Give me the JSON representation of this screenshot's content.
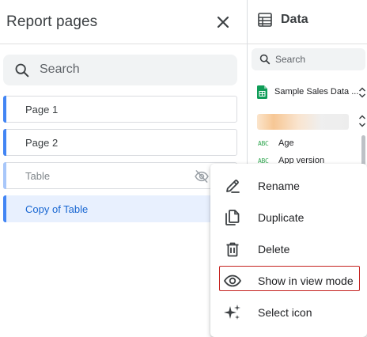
{
  "report_pages": {
    "title": "Report pages",
    "search": {
      "placeholder": "Search",
      "value": ""
    },
    "pages": [
      {
        "label": "Page 1",
        "state": "normal"
      },
      {
        "label": "Page 2",
        "state": "normal"
      },
      {
        "label": "Table",
        "state": "hidden"
      },
      {
        "label": "Copy of Table",
        "state": "selected"
      }
    ]
  },
  "data_panel": {
    "title": "Data",
    "search": {
      "placeholder": "Search",
      "value": ""
    },
    "source": {
      "name": "Sample Sales Data ..."
    },
    "fields": [
      {
        "type_badge": "ABC",
        "name": "Age"
      },
      {
        "type_badge": "ABC",
        "name": "App version"
      }
    ]
  },
  "context_menu": {
    "items": [
      {
        "label": "Rename",
        "icon": "pencil-icon"
      },
      {
        "label": "Duplicate",
        "icon": "copy-icon"
      },
      {
        "label": "Delete",
        "icon": "trash-icon"
      },
      {
        "label": "Show in view mode",
        "icon": "eye-icon",
        "highlighted": true
      },
      {
        "label": "Select icon",
        "icon": "sparkle-icon"
      }
    ]
  },
  "colors": {
    "accent": "#4285f4",
    "selected_bg": "#e8f0fe",
    "selected_text": "#1967d2",
    "highlight_outline": "#c5221f",
    "field_type": "#34a853"
  }
}
